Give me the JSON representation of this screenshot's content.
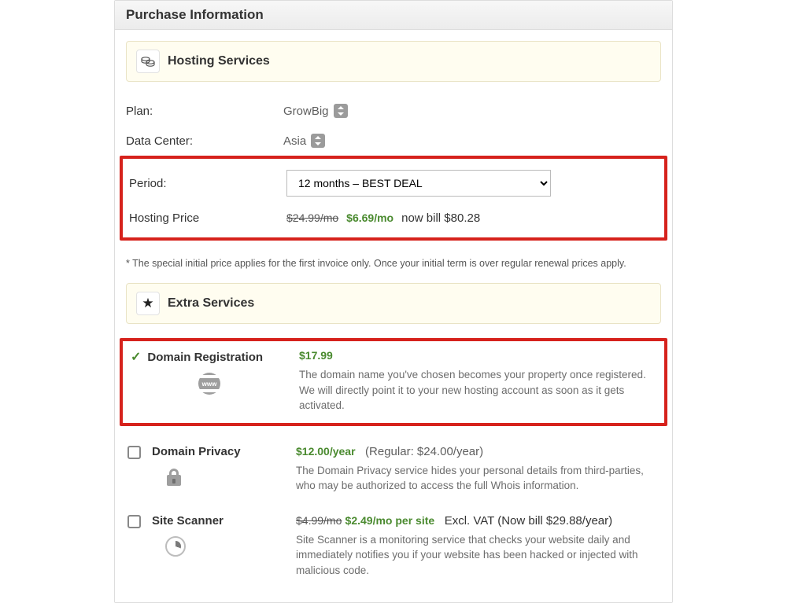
{
  "header": {
    "title": "Purchase Information"
  },
  "hosting": {
    "band_title": "Hosting Services",
    "plan_label": "Plan:",
    "plan_value": "GrowBig",
    "datacenter_label": "Data Center:",
    "datacenter_value": "Asia",
    "period_label": "Period:",
    "period_selected": "12 months – BEST DEAL",
    "price_label": "Hosting Price",
    "price_struck": "$24.99/mo",
    "price_current": "$6.69/mo",
    "price_now_bill": "now bill $80.28"
  },
  "disclaimer": "* The special initial price applies for the first invoice only. Once your initial term is over regular renewal prices apply.",
  "extras": {
    "band_title": "Extra Services",
    "domain_reg": {
      "title": "Domain Registration",
      "price": "$17.99",
      "desc": "The domain name you've chosen becomes your property once registered. We will directly point it to your new hosting account as soon as it gets activated."
    },
    "domain_privacy": {
      "title": "Domain Privacy",
      "price": "$12.00/year",
      "regular": "(Regular: $24.00/year)",
      "desc": "The Domain Privacy service hides your personal details from third-parties, who may be authorized to access the full Whois information."
    },
    "site_scanner": {
      "title": "Site Scanner",
      "price_struck": "$4.99/mo",
      "price_current": "$2.49/mo per site",
      "excl": "Excl. VAT",
      "now_bill": "(Now bill $29.88/year)",
      "desc": "Site Scanner is a monitoring service that checks your website daily and immediately notifies you if your website has been hacked or injected with malicious code."
    }
  }
}
